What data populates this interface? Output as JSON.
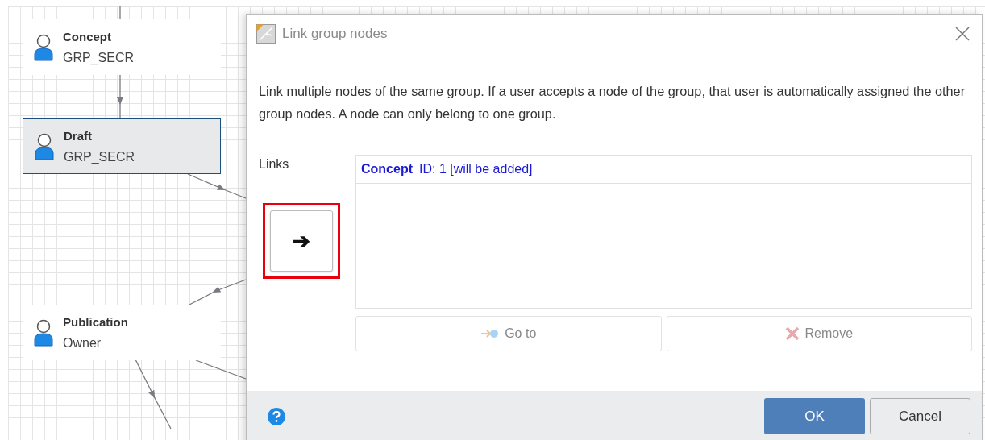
{
  "nodes": [
    {
      "title": "Concept",
      "role": "GRP_SECR",
      "selected": false
    },
    {
      "title": "Draft",
      "role": "GRP_SECR",
      "selected": true
    },
    {
      "title": "Publication",
      "role": "Owner",
      "selected": false
    }
  ],
  "dialog": {
    "title": "Link group nodes",
    "description": "Link multiple nodes of the same group. If a user accepts a node of the group, that user is automatically assigned the other group nodes. A node can only belong to one group.",
    "links_label": "Links",
    "links": [
      {
        "name": "Concept",
        "info": "ID: 1 [will be added]"
      }
    ],
    "add_button": {
      "label": "➔",
      "highlighted": true
    },
    "actions": [
      {
        "kind": "goto",
        "label": "Go to",
        "disabled": true
      },
      {
        "kind": "remove",
        "label": "Remove",
        "disabled": true
      }
    ],
    "footer_buttons": [
      {
        "label": "OK",
        "primary": true
      },
      {
        "label": "Cancel",
        "primary": false
      }
    ]
  }
}
